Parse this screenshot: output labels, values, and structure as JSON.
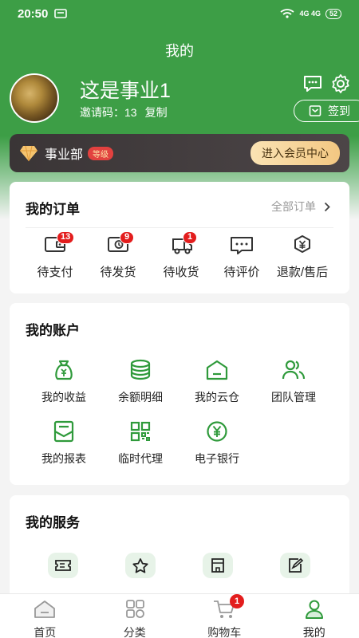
{
  "status_bar": {
    "time": "20:50",
    "signal": "4G 4G",
    "battery": "52"
  },
  "header": {
    "title": "我的"
  },
  "profile": {
    "username": "这是事业1",
    "invite_label": "邀请码：13",
    "copy_label": "复制",
    "signin_label": "签到"
  },
  "member": {
    "dept": "事业部",
    "level": "等级",
    "button": "进入会员中心"
  },
  "orders": {
    "title": "我的订单",
    "all_label": "全部订单",
    "items": [
      {
        "label": "待支付",
        "badge": "13",
        "icon": "wallet-icon"
      },
      {
        "label": "待发货",
        "badge": "9",
        "icon": "box-clock-icon"
      },
      {
        "label": "待收货",
        "badge": "1",
        "icon": "truck-icon"
      },
      {
        "label": "待评价",
        "badge": "",
        "icon": "comment-icon"
      },
      {
        "label": "退款/售后",
        "badge": "",
        "icon": "refund-icon"
      }
    ]
  },
  "account": {
    "title": "我的账户",
    "items": [
      {
        "label": "我的收益",
        "icon": "money-bag-icon"
      },
      {
        "label": "余额明细",
        "icon": "coins-icon"
      },
      {
        "label": "我的云仓",
        "icon": "warehouse-icon"
      },
      {
        "label": "团队管理",
        "icon": "team-icon"
      },
      {
        "label": "我的报表",
        "icon": "report-icon"
      },
      {
        "label": "临时代理",
        "icon": "qr-icon"
      },
      {
        "label": "电子银行",
        "icon": "yen-coin-icon"
      }
    ]
  },
  "services": {
    "title": "我的服务",
    "items": [
      {
        "icon": "coupon-icon"
      },
      {
        "icon": "star-icon"
      },
      {
        "icon": "shop-icon"
      },
      {
        "icon": "edit-icon"
      }
    ]
  },
  "tabbar": {
    "items": [
      {
        "label": "首页",
        "icon": "home-icon"
      },
      {
        "label": "分类",
        "icon": "category-icon"
      },
      {
        "label": "购物车",
        "icon": "cart-icon",
        "badge": "1"
      },
      {
        "label": "我的",
        "icon": "profile-icon"
      }
    ]
  },
  "colors": {
    "brand": "#3d9e46",
    "badge": "#e31d1d",
    "icon_green": "#2f9a3b"
  }
}
